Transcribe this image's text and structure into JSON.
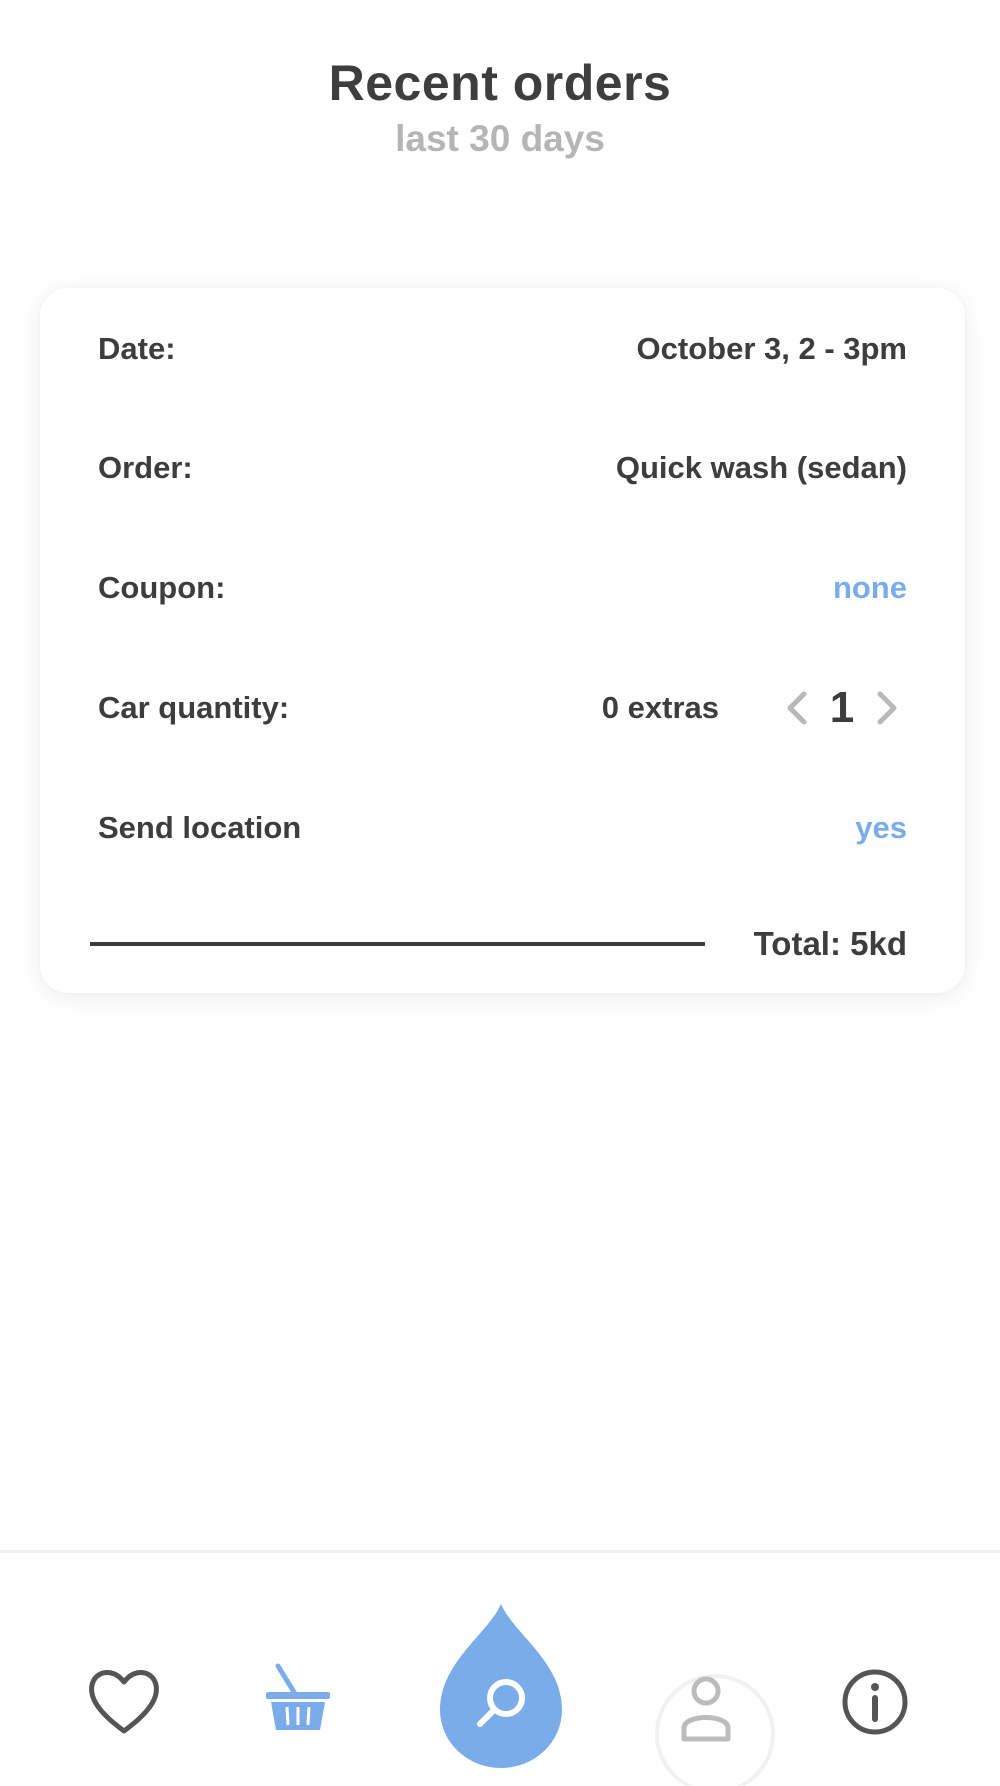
{
  "header": {
    "title": "Recent orders",
    "subtitle": "last 30 days"
  },
  "order": {
    "date_label": "Date:",
    "date_value": "October 3, 2 - 3pm",
    "order_label": "Order:",
    "order_value": "Quick wash (sedan)",
    "coupon_label": "Coupon:",
    "coupon_value": "none",
    "car_quantity_label": "Car quantity:",
    "extras_value": "0 extras",
    "quantity_value": "1",
    "send_location_label": "Send location",
    "send_location_value": "yes",
    "total": "Total: 5kd"
  },
  "tabbar": {
    "items": [
      {
        "name": "favorites",
        "icon": "heart-icon"
      },
      {
        "name": "basket",
        "icon": "basket-icon"
      },
      {
        "name": "search",
        "icon": "search-icon"
      },
      {
        "name": "profile",
        "icon": "user-icon"
      },
      {
        "name": "info",
        "icon": "info-icon"
      }
    ]
  },
  "colors": {
    "accent": "#7aacea",
    "text": "#3d3d3d",
    "muted": "#b5b5b5",
    "icon_gray": "#555555"
  }
}
